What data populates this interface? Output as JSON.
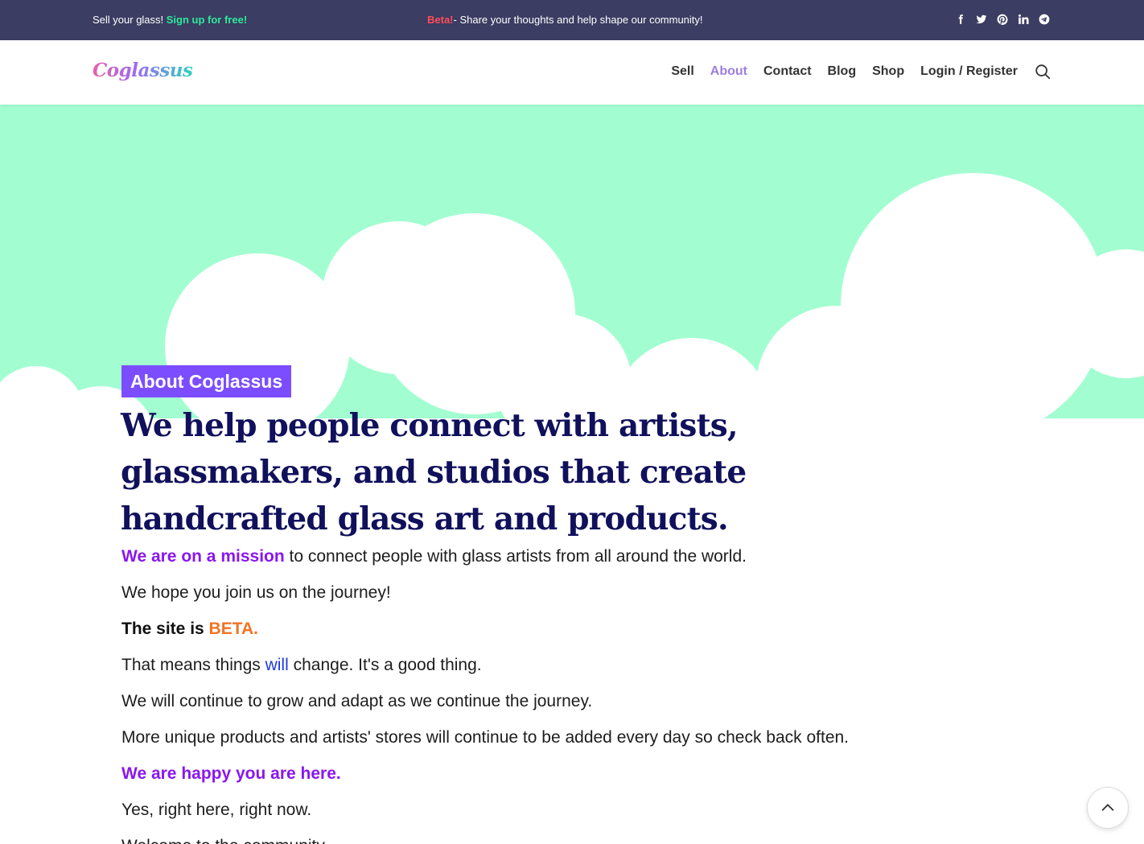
{
  "topbar": {
    "left_text": "Sell your glass! ",
    "left_link": "Sign up for free!",
    "beta_label": "Beta!",
    "beta_text": "- Share your thoughts and help shape our community!",
    "social_icons": [
      "facebook-icon",
      "twitter-icon",
      "pinterest-icon",
      "linkedin-icon",
      "telegram-icon"
    ]
  },
  "header": {
    "logo": "Coglassus",
    "nav": [
      {
        "label": "Sell"
      },
      {
        "label": "About"
      },
      {
        "label": "Contact"
      },
      {
        "label": "Blog"
      },
      {
        "label": "Shop"
      },
      {
        "label": "Login / Register"
      }
    ],
    "active_nav": "About",
    "search_icon": "search-icon"
  },
  "hero": {
    "badge": "About Coglassus",
    "headline": "We help people connect with artists, glassmakers, and studios that create handcrafted glass art and products."
  },
  "content": {
    "p1_highlight": "We are on a mission",
    "p1_rest": " to connect people with glass artists from all around the world.",
    "p2": "We hope you join us on the journey!",
    "p3_bold": "The site is ",
    "p3_highlight": "BETA.",
    "p4_a": "That means things ",
    "p4_highlight": "will",
    "p4_b": " change. It's a good thing.",
    "p5": "We will continue to grow and adapt as we continue the journey.",
    "p6": "More unique products and artists' stores will continue to be added every day so check back often.",
    "p7": "We are happy you are here.",
    "p8": "Yes, right here, right now.",
    "p9": "Welcome to the community."
  },
  "colors": {
    "topbar_bg": "#3b3d62",
    "hero_bg": "#a2fed1",
    "badge_bg": "#7c4dff",
    "headline": "#10105c",
    "accent_purple": "#8a16f0",
    "accent_orange": "#f27323",
    "accent_blue": "#1a3cdd",
    "signup_green": "#2ee89a",
    "beta_red": "#ff4d57"
  },
  "scroll_top_icon": "chevron-up-icon"
}
